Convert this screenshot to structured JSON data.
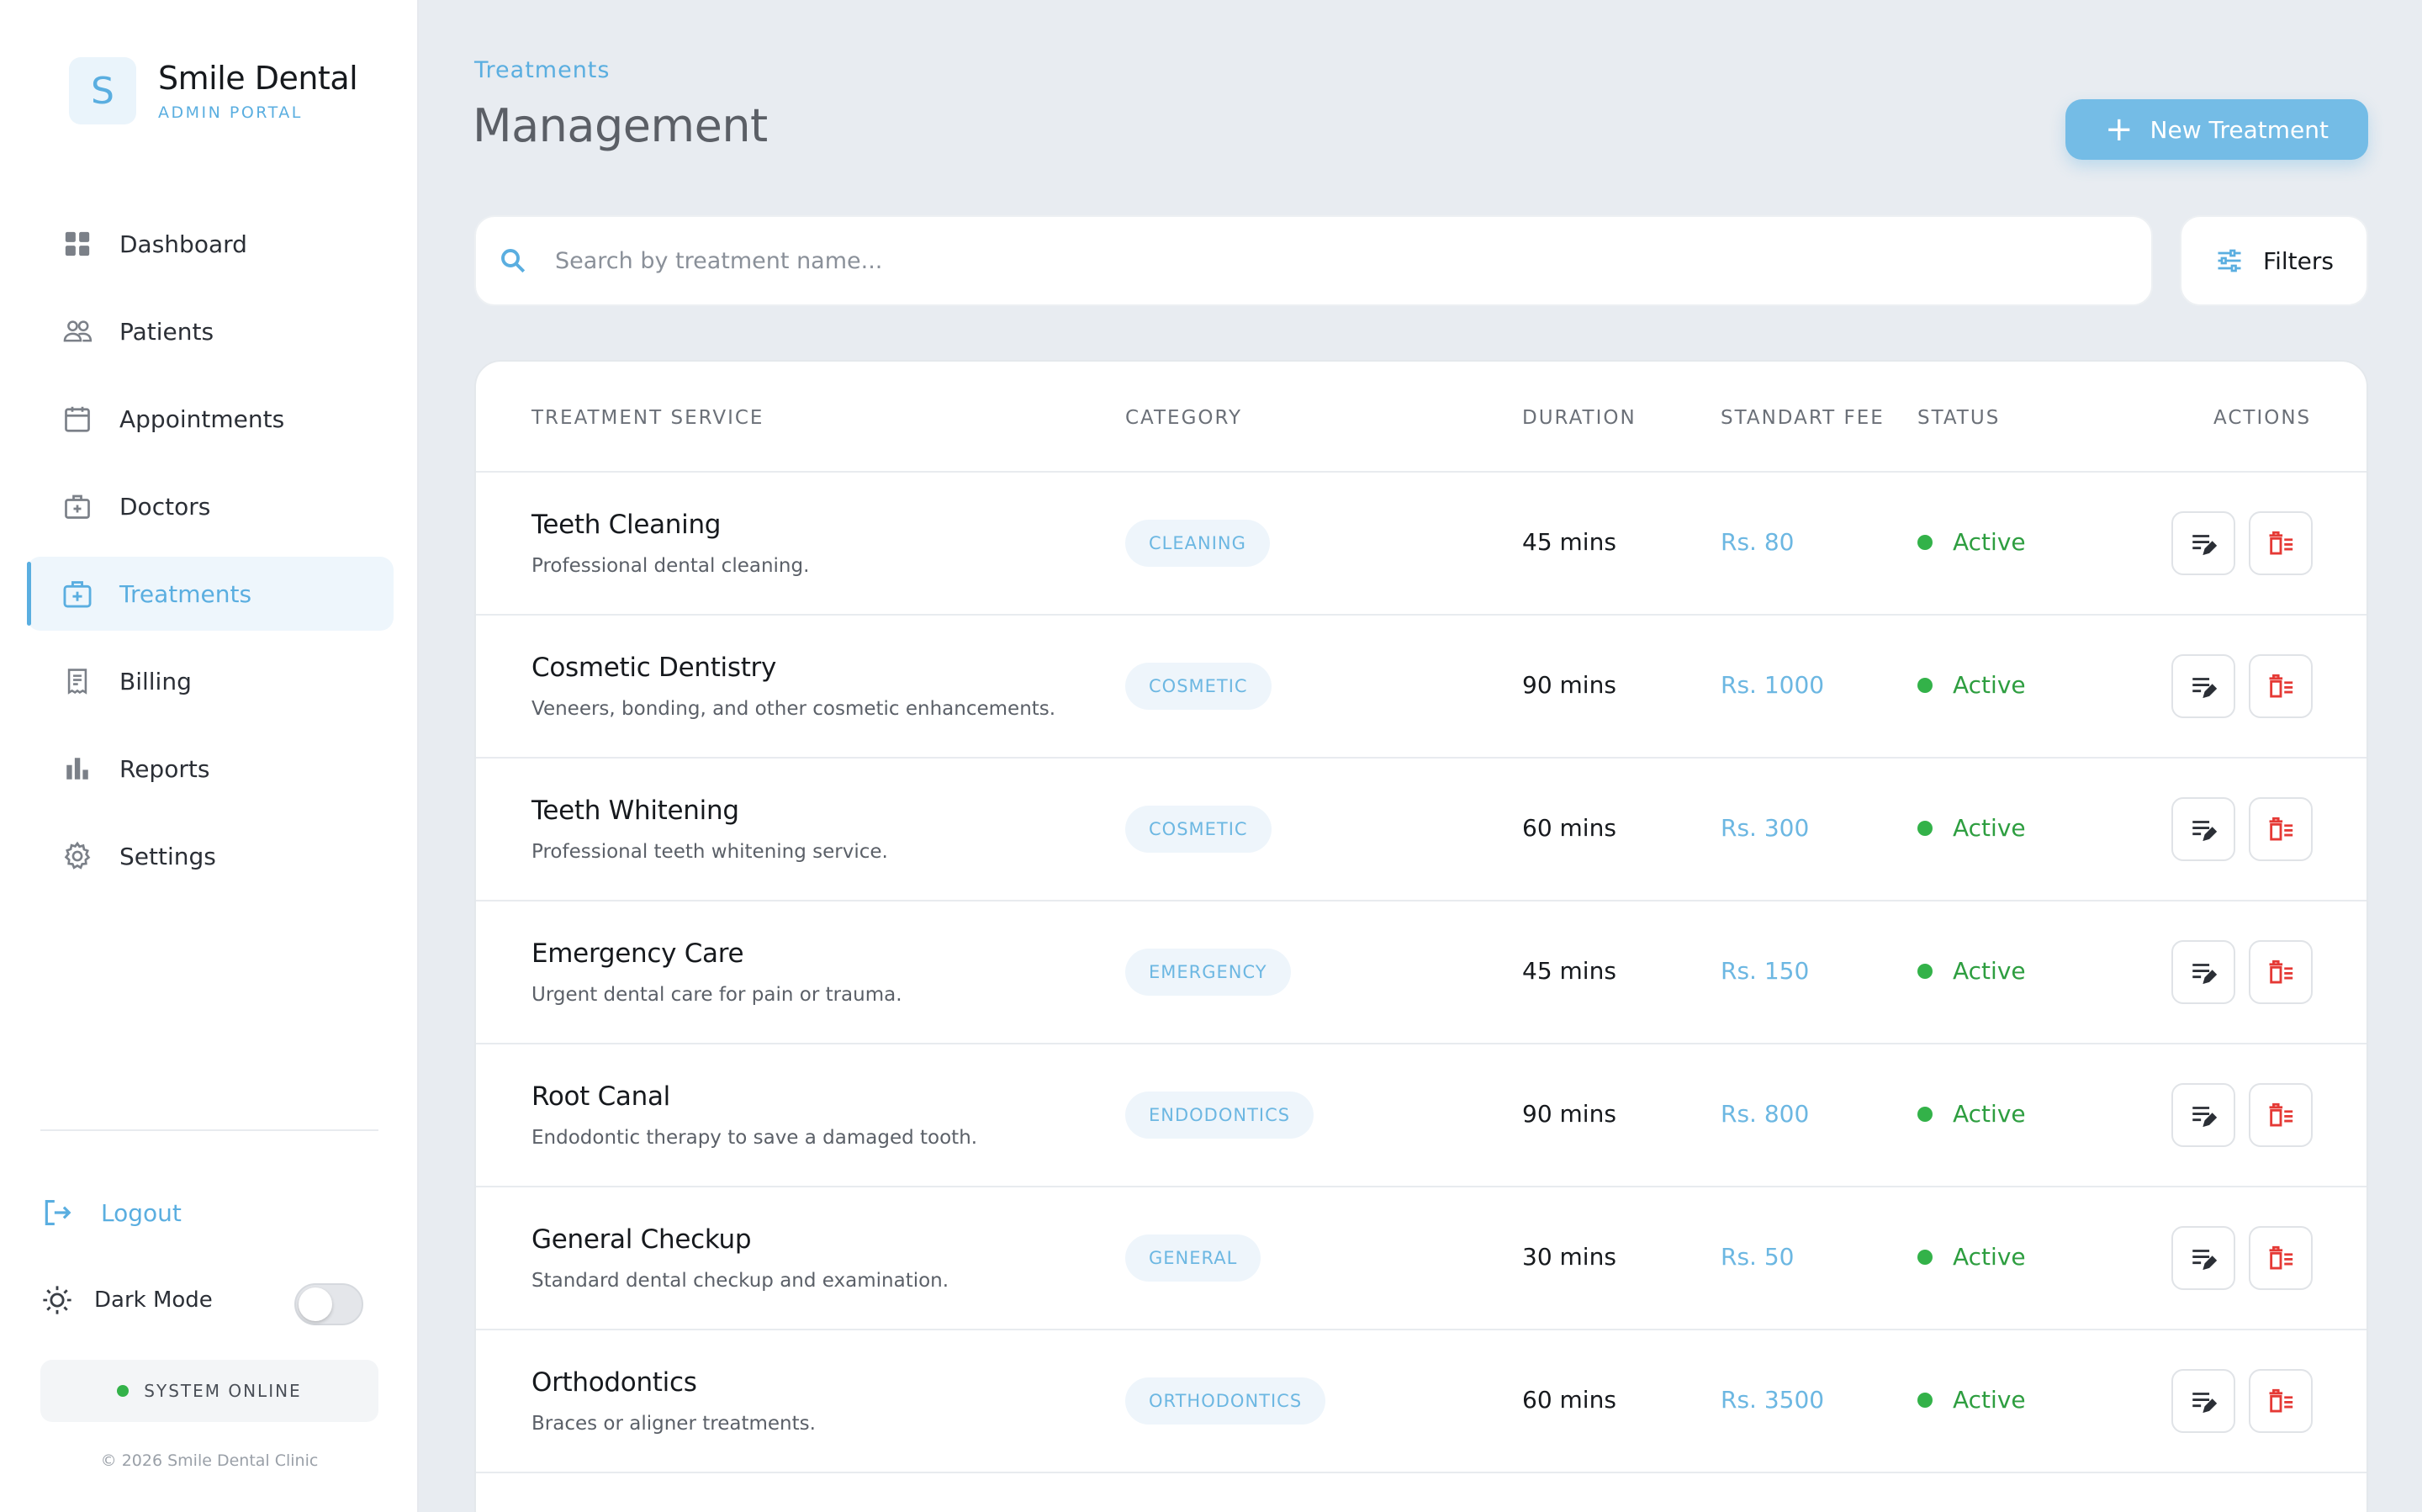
{
  "brand": {
    "logo_letter": "S",
    "name": "Smile Dental",
    "subtitle": "ADMIN PORTAL"
  },
  "sidebar": {
    "items": [
      {
        "label": "Dashboard",
        "icon": "grid-icon",
        "active": false
      },
      {
        "label": "Patients",
        "icon": "users-icon",
        "active": false
      },
      {
        "label": "Appointments",
        "icon": "calendar-icon",
        "active": false
      },
      {
        "label": "Doctors",
        "icon": "doctor-badge-icon",
        "active": false
      },
      {
        "label": "Treatments",
        "icon": "medical-kit-icon",
        "active": true
      },
      {
        "label": "Billing",
        "icon": "receipt-icon",
        "active": false
      },
      {
        "label": "Reports",
        "icon": "bar-chart-icon",
        "active": false
      },
      {
        "label": "Settings",
        "icon": "gear-icon",
        "active": false
      }
    ],
    "logout_label": "Logout",
    "dark_mode_label": "Dark Mode",
    "dark_mode_on": false,
    "system_status": "SYSTEM ONLINE",
    "copyright": "© 2026 Smile Dental Clinic"
  },
  "header": {
    "breadcrumb": "Treatments",
    "title": "Management",
    "new_button_label": "New Treatment"
  },
  "search": {
    "placeholder": "Search by treatment name...",
    "value": ""
  },
  "filters_label": "Filters",
  "table": {
    "columns": {
      "service": "TREATMENT SERVICE",
      "category": "CATEGORY",
      "duration": "DURATION",
      "fee": "STANDART FEE",
      "status": "STATUS",
      "actions": "ACTIONS"
    },
    "rows": [
      {
        "name": "Teeth Cleaning",
        "desc": "Professional dental cleaning.",
        "category": "CLEANING",
        "duration": "45 mins",
        "fee": "Rs. 80",
        "status": "Active"
      },
      {
        "name": "Cosmetic Dentistry",
        "desc": "Veneers, bonding, and other cosmetic enhancements.",
        "category": "COSMETIC",
        "duration": "90 mins",
        "fee": "Rs. 1000",
        "status": "Active"
      },
      {
        "name": "Teeth Whitening",
        "desc": "Professional teeth whitening service.",
        "category": "COSMETIC",
        "duration": "60 mins",
        "fee": "Rs. 300",
        "status": "Active"
      },
      {
        "name": "Emergency Care",
        "desc": "Urgent dental care for pain or trauma.",
        "category": "EMERGENCY",
        "duration": "45 mins",
        "fee": "Rs. 150",
        "status": "Active"
      },
      {
        "name": "Root Canal",
        "desc": "Endodontic therapy to save a damaged tooth.",
        "category": "ENDODONTICS",
        "duration": "90 mins",
        "fee": "Rs. 800",
        "status": "Active"
      },
      {
        "name": "General Checkup",
        "desc": "Standard dental checkup and examination.",
        "category": "GENERAL",
        "duration": "30 mins",
        "fee": "Rs. 50",
        "status": "Active"
      },
      {
        "name": "Orthodontics",
        "desc": "Braces or aligner treatments.",
        "category": "ORTHODONTICS",
        "duration": "60 mins",
        "fee": "Rs. 3500",
        "status": "Active"
      }
    ]
  },
  "colors": {
    "accent": "#5aaee0",
    "active_green": "#33b249",
    "delete_red": "#e53935",
    "background": "#e8ecf1"
  }
}
